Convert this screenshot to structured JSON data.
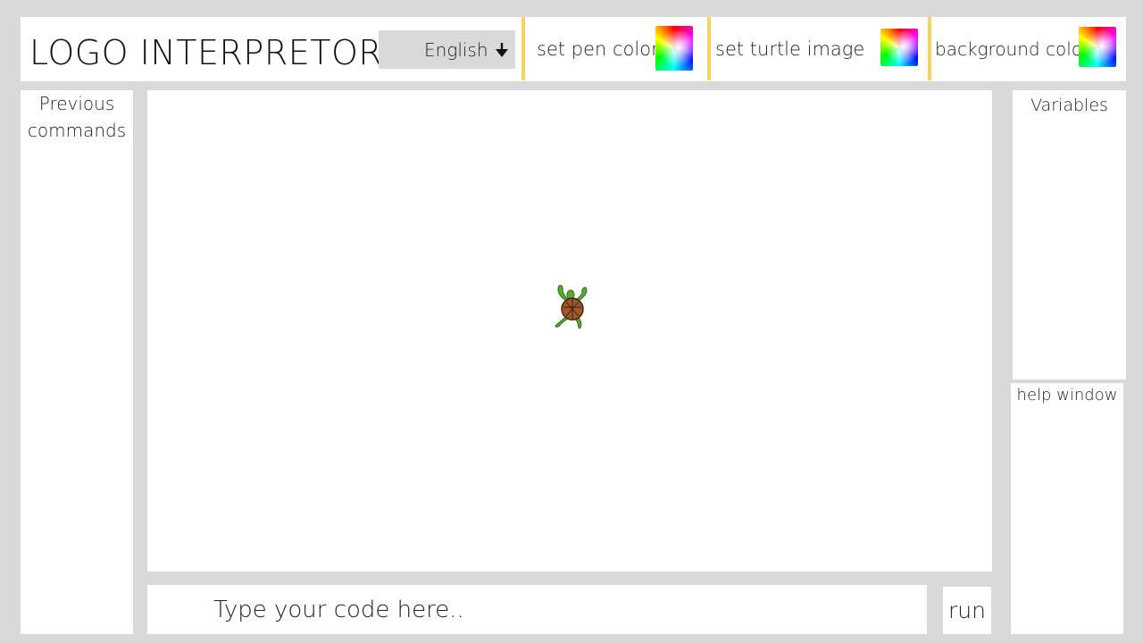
{
  "header": {
    "title": "LOGO INTERPRETOR",
    "language": {
      "selected": "English",
      "arrow_icon": "arrow-down-icon"
    },
    "pen_color_label": "set pen color",
    "turtle_image_label": "set turtle image",
    "background_color_label": "background color",
    "swatch_icon": "color-picker-icon",
    "divider_color": "#f7d35a"
  },
  "previous_commands": {
    "title_line1": "Previous",
    "title_line2": "commands"
  },
  "canvas": {
    "turtle_icon": "turtle-icon"
  },
  "code": {
    "placeholder": "Type your code here.."
  },
  "run_button": {
    "label": "run"
  },
  "variables": {
    "title": "Variables"
  },
  "help": {
    "title": "help window"
  },
  "colors": {
    "page_background": "#d9d9d9",
    "panel_background": "#ffffff",
    "select_background": "#d9d9d9",
    "accent": "#f7d35a"
  }
}
